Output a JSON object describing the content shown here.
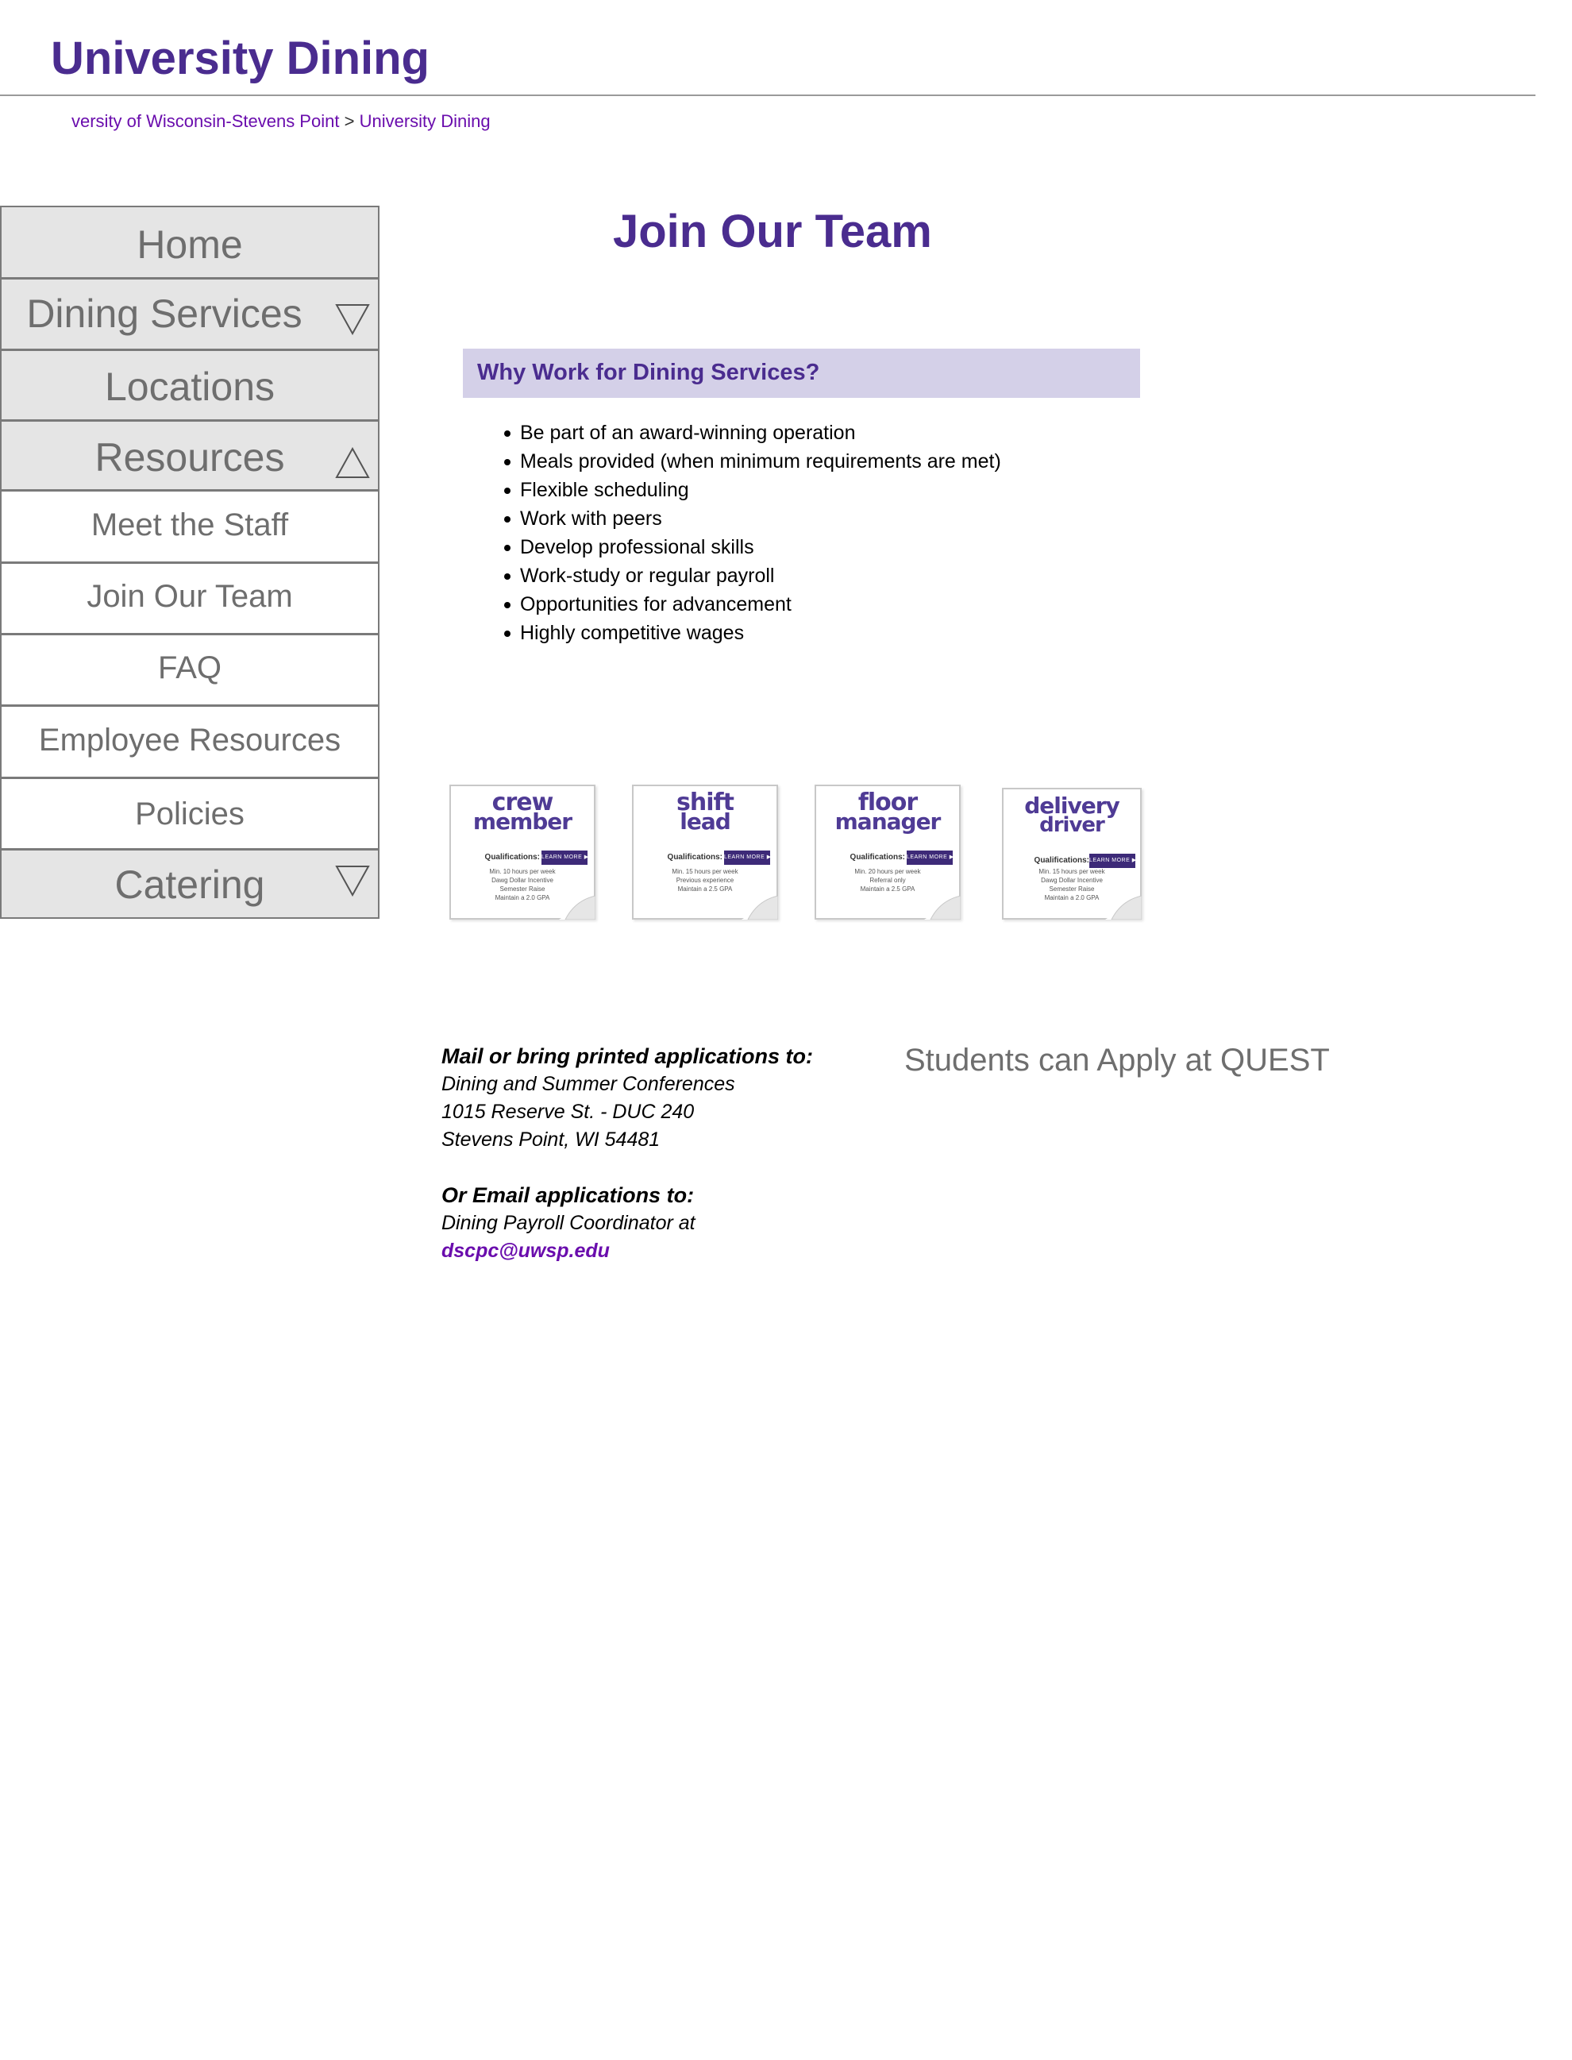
{
  "site": {
    "title": "University Dining"
  },
  "breadcrumb": {
    "parent": "versity of Wisconsin-Stevens Point",
    "separator": ">",
    "current": "University Dining"
  },
  "sidebar": {
    "items": [
      {
        "label": "Home",
        "type": "main"
      },
      {
        "label": "Dining Services",
        "type": "main",
        "indicator": "collapsed"
      },
      {
        "label": "Locations",
        "type": "main"
      },
      {
        "label": "Resources",
        "type": "main",
        "indicator": "expanded"
      },
      {
        "label": "Meet the Staff",
        "type": "sub"
      },
      {
        "label": "Join Our Team",
        "type": "sub"
      },
      {
        "label": "FAQ",
        "type": "sub"
      },
      {
        "label": "Employee Resources",
        "type": "sub"
      },
      {
        "label": "Policies",
        "type": "sub"
      },
      {
        "label": "Catering",
        "type": "main",
        "indicator": "collapsed"
      }
    ]
  },
  "main": {
    "title": "Join Our Team",
    "why_heading": "Why Work for Dining Services?",
    "benefits": [
      "Be part of an award-winning operation",
      "Meals provided (when minimum requirements are met)",
      "Flexible scheduling",
      "Work with peers",
      "Develop professional skills",
      "Work-study or regular payroll",
      "Opportunities for advancement",
      "Highly competitive wages"
    ],
    "jobs": [
      {
        "line1": "crew",
        "line2": "member",
        "qualifications_label": "Qualifications:",
        "button": "LEARN MORE ▶",
        "requirements": [
          "Min. 10 hours per week",
          "Dawg Dollar Incentive",
          "Semester Raise",
          "Maintain a 2.0 GPA"
        ]
      },
      {
        "line1": "shift",
        "line2": "lead",
        "qualifications_label": "Qualifications:",
        "button": "LEARN MORE ▶",
        "requirements": [
          "Min. 15 hours per week",
          "Previous experience",
          "Maintain a 2.5 GPA"
        ]
      },
      {
        "line1": "floor",
        "line2": "manager",
        "qualifications_label": "Qualifications:",
        "button": "LEARN MORE ▶",
        "requirements": [
          "Min. 20 hours per week",
          "Referral only",
          "Maintain a 2.5 GPA"
        ]
      },
      {
        "line1": "delivery",
        "line2": "driver",
        "qualifications_label": "Qualifications:",
        "button": "LEARN MORE ▶",
        "requirements": [
          "Min. 15 hours per week",
          "Dawg Dollar Incentive",
          "Semester Raise",
          "Maintain a 2.0 GPA"
        ]
      }
    ],
    "apply": {
      "mail_heading": "Mail or bring printed applications to:",
      "address_line1": "Dining and Summer Conferences",
      "address_line2": "1015 Reserve St. - DUC 240",
      "address_line3": "Stevens Point, WI 54481",
      "email_heading": "Or Email applications to:",
      "email_text": "Dining Payroll Coordinator at",
      "email": "dscpc@uwsp.edu"
    },
    "quest_text": "Students can Apply at QUEST"
  },
  "colors": {
    "brand_purple": "#4a2c8f",
    "link_purple": "#6a0dad",
    "nav_gray": "#e5e5e5",
    "highlight_box": "#d4d0e8"
  }
}
